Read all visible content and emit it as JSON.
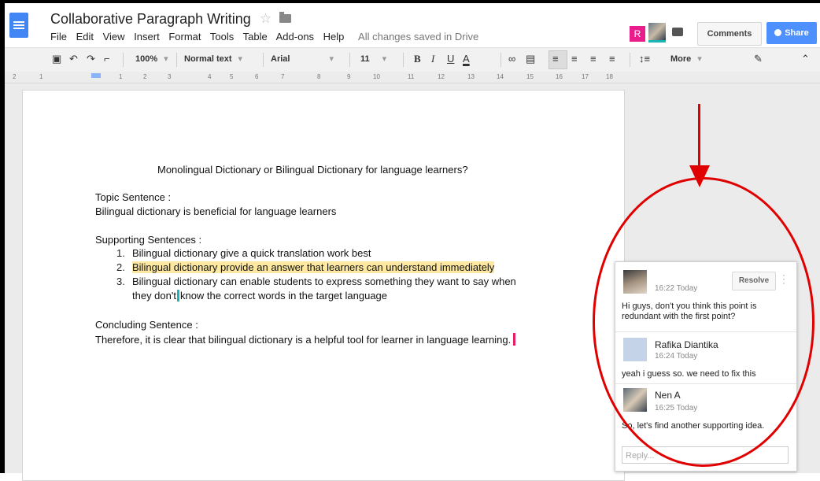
{
  "header": {
    "title": "Collaborative Paragraph Writing",
    "menu": [
      "File",
      "Edit",
      "View",
      "Insert",
      "Format",
      "Tools",
      "Table",
      "Add-ons",
      "Help"
    ],
    "saved_status": "All changes saved in Drive",
    "avatar_initial": "R",
    "comments_label": "Comments",
    "share_label": "Share"
  },
  "toolbar": {
    "zoom": "100%",
    "style": "Normal text",
    "font": "Arial",
    "size": "11",
    "more_label": "More"
  },
  "ruler": [
    "2",
    "1",
    "1",
    "2",
    "3",
    "4",
    "5",
    "6",
    "7",
    "8",
    "9",
    "10",
    "11",
    "12",
    "13",
    "14",
    "15",
    "16",
    "17",
    "18"
  ],
  "document": {
    "heading": "Monolingual Dictionary or Bilingual Dictionary for language learners?",
    "topic_label": "Topic Sentence :",
    "topic_text": "Bilingual dictionary is beneficial for language learners",
    "supporting_label": "Supporting Sentences :",
    "items": [
      {
        "num": "1.",
        "text": "Bilingual dictionary give a quick translation work best"
      },
      {
        "num": "2.",
        "text": "Bilingual dictionary provide an answer that learners can understand immediately"
      },
      {
        "num": "3.",
        "text": "Bilingual dictionary can enable students to express something they want to say when"
      }
    ],
    "item3_cont_a": "they don't",
    "item3_cont_b": "know the correct words in the target language",
    "concluding_label": "Concluding Sentence :",
    "concluding_text": "Therefore, it is clear that bilingual dictionary is a helpful tool for learner in language learning."
  },
  "comments": {
    "resolve_label": "Resolve",
    "thread": [
      {
        "author": "",
        "time": "16:22 Today",
        "text": "Hi guys, don't you think this point is redundant with the first point?"
      },
      {
        "author": "Rafika Diantika",
        "time": "16:24 Today",
        "text": "yeah i guess so. we need to fix this"
      },
      {
        "author": "Nen A",
        "time": "16:25 Today",
        "text": "So, let's find another supporting idea."
      }
    ],
    "reply_placeholder": "Reply..."
  },
  "colors": {
    "accent": "#4d90fe",
    "highlight": "#fce8a1",
    "annotation": "#e00000"
  }
}
